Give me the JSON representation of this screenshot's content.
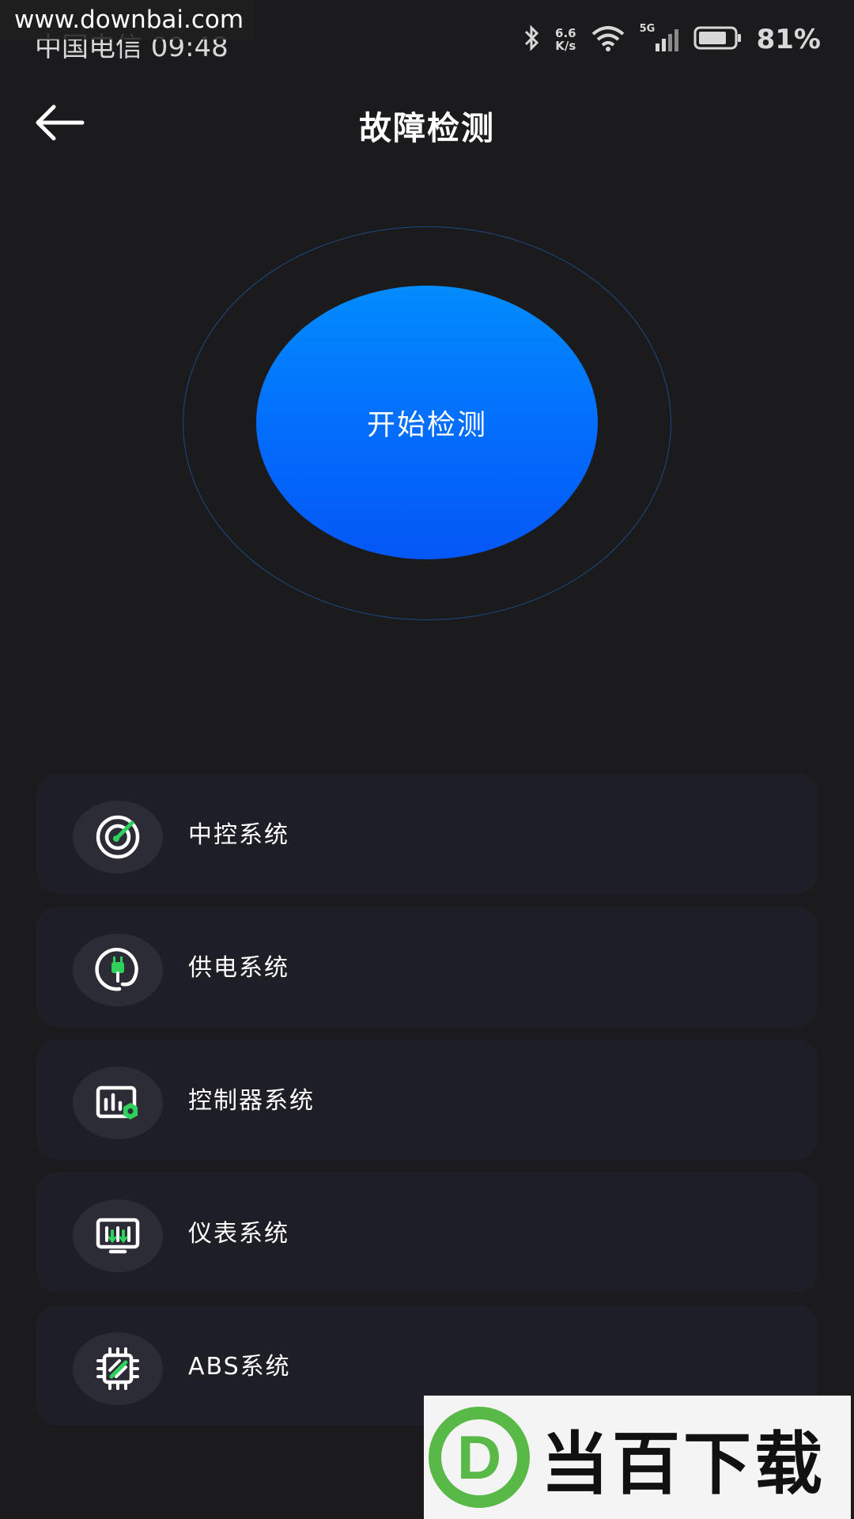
{
  "watermark_top": "www.downbai.com",
  "status_bar": {
    "carrier_time": "中国电信 09:48",
    "net_speed_value": "6.6",
    "net_speed_unit": "K/s",
    "network_label": "5G",
    "battery": "81%",
    "battery_level": 0.81
  },
  "header": {
    "title": "故障检测"
  },
  "scan": {
    "label": "开始检测",
    "ring_color": "#1d4a82",
    "gradient_top": "#028cfd",
    "gradient_bottom": "#0457f5"
  },
  "systems": [
    {
      "label": "中控系统",
      "icon": "radar-icon"
    },
    {
      "label": "供电系统",
      "icon": "power-plug-icon"
    },
    {
      "label": "控制器系统",
      "icon": "controller-chart-icon"
    },
    {
      "label": "仪表系统",
      "icon": "dashboard-monitor-icon"
    },
    {
      "label": "ABS系统",
      "icon": "chip-icon"
    }
  ],
  "accent_green": "#2fd15c",
  "watermark_bottom": {
    "logo_letter": "D",
    "text": "当百下载"
  }
}
